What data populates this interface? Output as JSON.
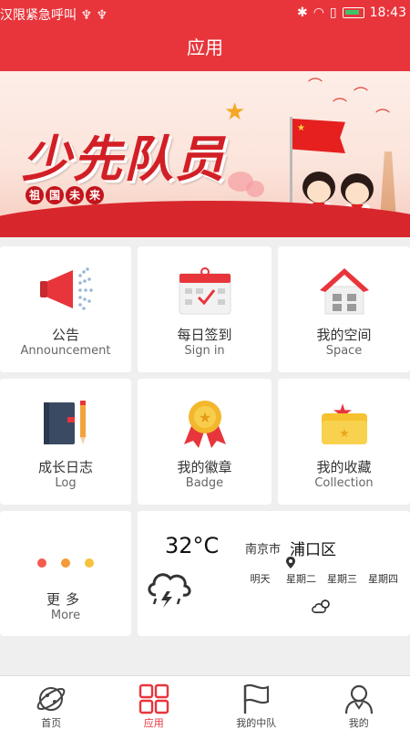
{
  "status_bar": {
    "left_text": "汉限紧急呼叫 ♆ ♆",
    "time": "18:43"
  },
  "header": {
    "title": "应用"
  },
  "banner": {
    "title": "少先队员",
    "subtitle_chars": [
      "祖",
      "国",
      "未",
      "来"
    ]
  },
  "apps": [
    {
      "name": "announcement",
      "cn": "公告",
      "en": "Announcement",
      "icon": "megaphone-icon"
    },
    {
      "name": "sign-in",
      "cn": "每日签到",
      "en": "Sign in",
      "icon": "calendar-check-icon"
    },
    {
      "name": "space",
      "cn": "我的空间",
      "en": "Space",
      "icon": "house-icon"
    },
    {
      "name": "log",
      "cn": "成长日志",
      "en": "Log",
      "icon": "notebook-pencil-icon"
    },
    {
      "name": "badge",
      "cn": "我的徽章",
      "en": "Badge",
      "icon": "medal-icon"
    },
    {
      "name": "collection",
      "cn": "我的收藏",
      "en": "Collection",
      "icon": "star-folder-icon"
    }
  ],
  "more": {
    "cn": "更多",
    "en": "More",
    "dot_colors": [
      "#f25b4e",
      "#f59a38",
      "#f6c23a"
    ]
  },
  "weather": {
    "temperature": "32°C",
    "city": "南京市",
    "district": "浦口区",
    "forecast": [
      {
        "day": "明天",
        "icon": "cloudy-sun-icon"
      },
      {
        "day": "星期二",
        "icon": "cloudy-sun-icon"
      },
      {
        "day": "星期三",
        "icon": "cloudy-sun-icon"
      },
      {
        "day": "星期四",
        "icon": "cloudy-sun-icon"
      }
    ]
  },
  "bottom_nav": [
    {
      "label": "首页",
      "icon": "planet-icon",
      "active": false
    },
    {
      "label": "应用",
      "icon": "apps-grid-icon",
      "active": true
    },
    {
      "label": "我的中队",
      "icon": "flag-icon",
      "active": false
    },
    {
      "label": "我的",
      "icon": "person-icon",
      "active": false
    }
  ],
  "colors": {
    "primary": "#e8353c",
    "background": "#efefef"
  }
}
